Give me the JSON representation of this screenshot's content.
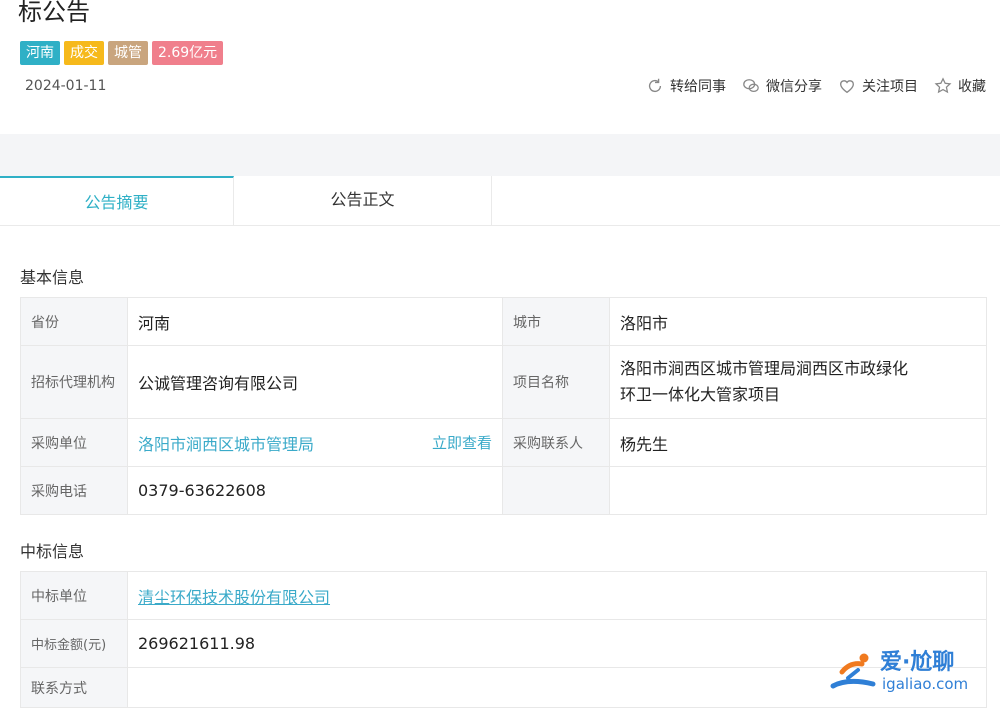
{
  "header": {
    "title_tail": "标公告",
    "tags": [
      {
        "label": "河南",
        "color": "#2fb0c6"
      },
      {
        "label": "成交",
        "color": "#f6b91b"
      },
      {
        "label": "城管",
        "color": "#c9a57e"
      },
      {
        "label": "2.69亿元",
        "color": "#f07f8c"
      }
    ],
    "date": "2024-01-11",
    "actions": {
      "forward": "转给同事",
      "wechat": "微信分享",
      "follow": "关注项目",
      "favorite": "收藏"
    }
  },
  "tabs": {
    "summary": "公告摘要",
    "body": "公告正文"
  },
  "basic": {
    "title": "基本信息",
    "province_label": "省份",
    "province": "河南",
    "city_label": "城市",
    "city": "洛阳市",
    "agency_label": "招标代理机构",
    "agency": "公诚管理咨询有限公司",
    "project_label": "项目名称",
    "project_line1": "洛阳市涧西区城市管理局涧西区市政绿化",
    "project_line2": "环卫一体化大管家项目",
    "purchaser_label": "采购单位",
    "purchaser": "洛阳市涧西区城市管理局",
    "view_now": "立即查看",
    "contact_label": "采购联系人",
    "contact": "杨先生",
    "phone_label": "采购电话",
    "phone": "0379-63622608"
  },
  "award": {
    "title": "中标信息",
    "winner_label": "中标单位",
    "winner": "清尘环保技术股份有限公司",
    "amount_label": "中标金额(元)",
    "amount": "269621611.98",
    "contact_label": "联系方式"
  },
  "watermark": {
    "text": "爱·尬聊",
    "url": "igaliao.com"
  }
}
